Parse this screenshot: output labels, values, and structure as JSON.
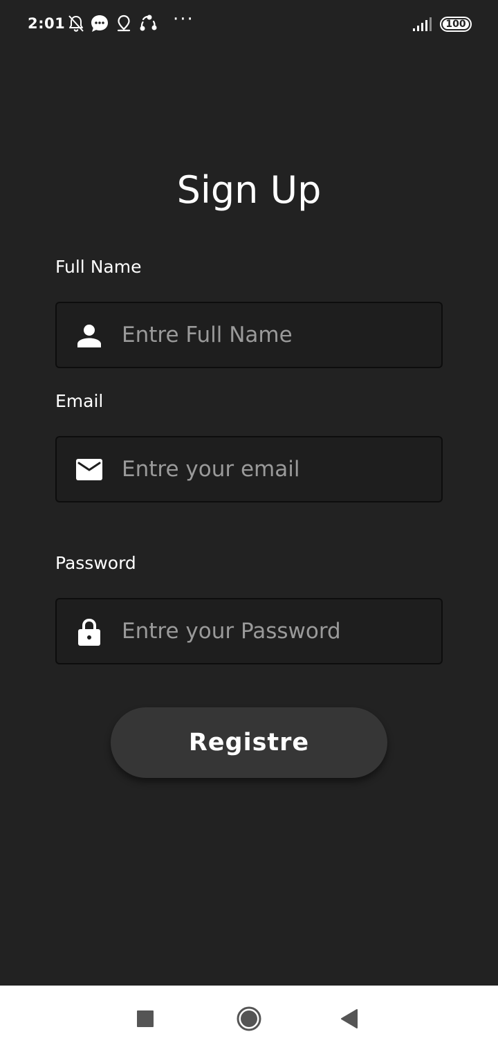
{
  "status_bar": {
    "time": "2:01",
    "icons": [
      "notifications-off-icon",
      "chat-bubble-icon",
      "location-pin-icon",
      "share-sync-icon"
    ],
    "more": "···",
    "battery_level": "100"
  },
  "screen": {
    "title": "Sign Up",
    "background_color": "#222222"
  },
  "form": {
    "full_name": {
      "label": "Full Name",
      "placeholder": "Entre Full Name",
      "icon": "person-icon"
    },
    "email": {
      "label": "Email",
      "placeholder": "Entre your email",
      "icon": "mail-icon"
    },
    "password": {
      "label": "Password",
      "placeholder": "Entre your Password",
      "icon": "lock-icon"
    },
    "submit": {
      "label": "Registre",
      "color": "#363636"
    }
  },
  "nav_bar": {
    "buttons": [
      "recent-apps-icon",
      "home-icon",
      "back-icon"
    ]
  }
}
